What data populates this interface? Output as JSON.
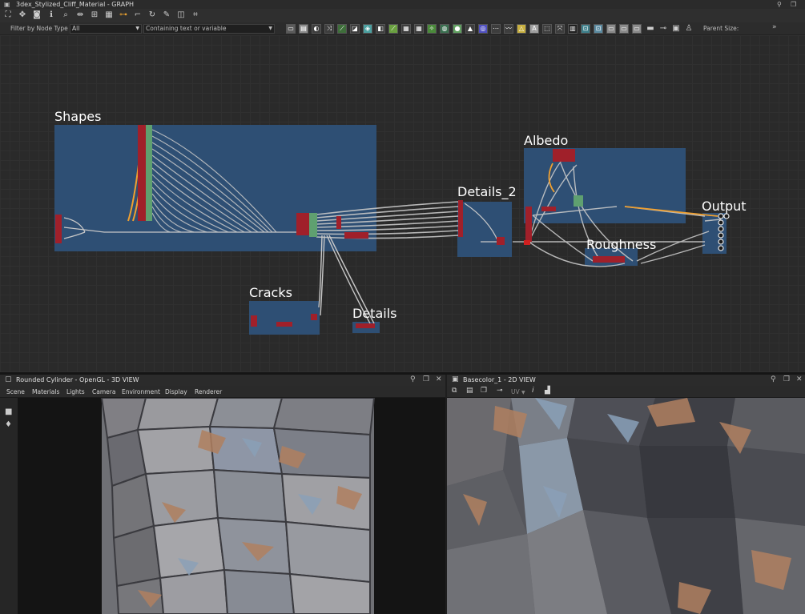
{
  "window": {
    "title": "3dex_Stylized_Cliff_Material - GRAPH"
  },
  "toolbar": {
    "icons": [
      "fit-view",
      "pan",
      "screenshot",
      "info",
      "search",
      "align",
      "hierarchy",
      "grid",
      "link",
      "layout",
      "refresh",
      "tools",
      "frame",
      "crop"
    ]
  },
  "filter": {
    "node_type_label": "Filter by Node Type",
    "node_type_value": "All",
    "text_placeholder": "Containing text or variable",
    "parent_size_label": "Parent Size:",
    "more": "»",
    "atom_letter": "A"
  },
  "graph": {
    "frames": [
      {
        "title": "Shapes"
      },
      {
        "title": "Cracks"
      },
      {
        "title": "Details"
      },
      {
        "title": "Details_2"
      },
      {
        "title": "Albedo"
      },
      {
        "title": "Roughness"
      },
      {
        "title": "Output"
      }
    ]
  },
  "view3d": {
    "title": "Rounded Cylinder - OpenGL - 3D VIEW",
    "menu": [
      "Scene",
      "Materials",
      "Lights",
      "Camera",
      "Environment",
      "Display",
      "Renderer"
    ]
  },
  "view2d": {
    "title": "Basecolor_1 - 2D VIEW",
    "uv_label": "UV",
    "info_glyph": "i"
  },
  "colors": {
    "frame_blue": "#2e4f74",
    "graph_bg": "#2a2a2a",
    "link_highlight": "#f0a030",
    "node_red": "#a0202a",
    "node_green": "#5fa070",
    "rock_blue": "#8aa0b8",
    "rock_orange": "#b08060"
  }
}
